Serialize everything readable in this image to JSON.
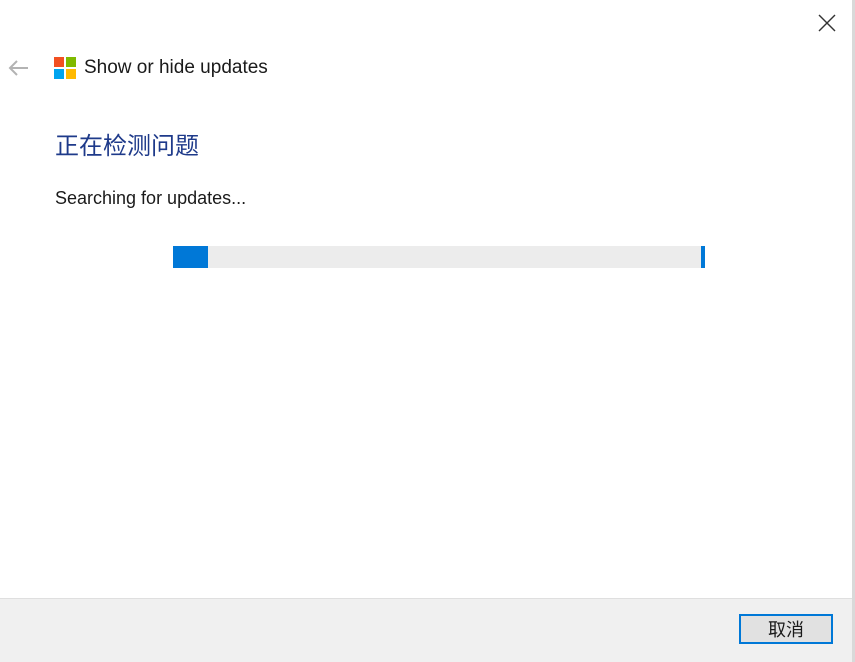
{
  "window": {
    "close_icon": "close-icon",
    "back_icon": "back-arrow-icon"
  },
  "header": {
    "title": "Show or hide updates",
    "logo_icon": "windows-logo-icon",
    "logo_colors": [
      "#f25022",
      "#7fba00",
      "#00a4ef",
      "#ffb900"
    ]
  },
  "main": {
    "heading": "正在检测问题",
    "status_text": "Searching for updates...",
    "progress": {
      "value_fraction": 0.065,
      "indeterminate": true
    }
  },
  "footer": {
    "cancel_label": "取消"
  },
  "colors": {
    "accent": "#0078d7",
    "heading": "#1e3a8a",
    "footer_bg": "#f0f0f0",
    "track": "#ececec"
  }
}
